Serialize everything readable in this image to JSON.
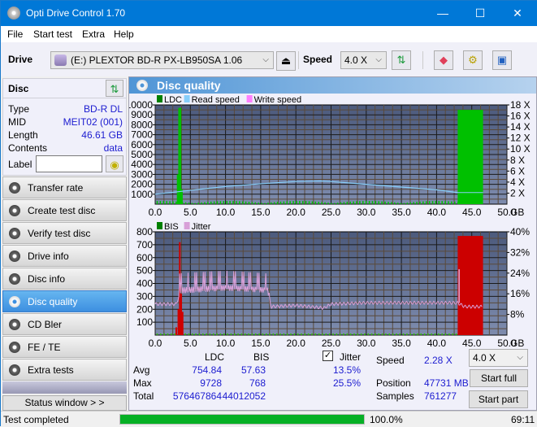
{
  "window": {
    "title": "Opti Drive Control 1.70",
    "minimize": "—",
    "maximize": "☐",
    "close": "✕"
  },
  "menu": [
    "File",
    "Start test",
    "Extra",
    "Help"
  ],
  "toolbar": {
    "drive_label": "Drive",
    "drive_value": "(E:)  PLEXTOR BD-R  PX-LB950SA 1.06",
    "speed_label": "Speed",
    "speed_value": "4.0 X"
  },
  "disc": {
    "header": "Disc",
    "rows": [
      {
        "key": "Type",
        "value": "BD-R DL"
      },
      {
        "key": "MID",
        "value": "MEIT02 (001)"
      },
      {
        "key": "Length",
        "value": "46.61 GB"
      },
      {
        "key": "Contents",
        "value": "data"
      }
    ],
    "label_key": "Label",
    "label_value": ""
  },
  "nav": [
    {
      "label": "Transfer rate",
      "active": false
    },
    {
      "label": "Create test disc",
      "active": false
    },
    {
      "label": "Verify test disc",
      "active": false
    },
    {
      "label": "Drive info",
      "active": false
    },
    {
      "label": "Disc info",
      "active": false
    },
    {
      "label": "Disc quality",
      "active": true
    },
    {
      "label": "CD Bler",
      "active": false
    },
    {
      "label": "FE / TE",
      "active": false
    },
    {
      "label": "Extra tests",
      "active": false
    }
  ],
  "status_window_button": "Status window > >",
  "panel_title": "Disc quality",
  "chart_data": [
    {
      "type": "bar",
      "title": "",
      "legend": [
        "LDC",
        "Read speed",
        "Write speed"
      ],
      "legend_colors": {
        "LDC": "#008000",
        "Read speed": "#87cefa",
        "Write speed": "#ff80ff"
      },
      "xlabel": "GB",
      "x_ticks": [
        "0.0",
        "5.0",
        "10.0",
        "15.0",
        "20.0",
        "25.0",
        "30.0",
        "35.0",
        "40.0",
        "45.0",
        "50.0"
      ],
      "xlim": [
        0,
        50
      ],
      "y_ticks_left": [
        "1000",
        "2000",
        "3000",
        "4000",
        "5000",
        "6000",
        "7000",
        "8000",
        "9000",
        "10000"
      ],
      "ylim_left": [
        0,
        10000
      ],
      "y_ticks_right": [
        "2 X",
        "4 X",
        "6 X",
        "8 X",
        "10 X",
        "12 X",
        "14 X",
        "16 X",
        "18 X"
      ],
      "ylim_right": [
        0,
        18
      ],
      "series": [
        {
          "name": "LDC spikes",
          "points": [
            [
              3.2,
              3000
            ],
            [
              3.4,
              9700
            ],
            [
              3.6,
              9728
            ],
            [
              3.8,
              1500
            ]
          ]
        },
        {
          "name": "LDC block",
          "range": [
            43.0,
            46.6
          ],
          "value": 9500
        },
        {
          "name": "LDC baseline",
          "value_approx": 250
        },
        {
          "name": "Read speed",
          "x": [
            0,
            5,
            10,
            15,
            20,
            23.5,
            25,
            30,
            35,
            40,
            43
          ],
          "values": [
            1.8,
            2.5,
            3.2,
            3.7,
            4.1,
            4.2,
            4.1,
            3.6,
            3.1,
            2.6,
            2.1
          ]
        }
      ]
    },
    {
      "type": "bar",
      "legend": [
        "BIS",
        "Jitter"
      ],
      "legend_colors": {
        "BIS": "#008000",
        "Jitter": "#d8a0d8"
      },
      "xlabel": "GB",
      "x_ticks": [
        "0.0",
        "5.0",
        "10.0",
        "15.0",
        "20.0",
        "25.0",
        "30.0",
        "35.0",
        "40.0",
        "45.0",
        "50.0"
      ],
      "xlim": [
        0,
        50
      ],
      "y_ticks_left": [
        "100",
        "200",
        "300",
        "400",
        "500",
        "600",
        "700",
        "800"
      ],
      "ylim_left": [
        0,
        800
      ],
      "y_ticks_right": [
        "8%",
        "16%",
        "24%",
        "32%",
        "40%"
      ],
      "ylim_right": [
        0,
        40
      ],
      "series": [
        {
          "name": "BIS spikes",
          "points": [
            [
              3.0,
              60
            ],
            [
              3.3,
              200
            ],
            [
              3.5,
              720
            ],
            [
              3.7,
              320
            ],
            [
              3.9,
              180
            ]
          ]
        },
        {
          "name": "BIS block",
          "range": [
            43.0,
            46.6
          ],
          "value": 768
        },
        {
          "name": "Jitter",
          "x": [
            0,
            3,
            3.5,
            10,
            16,
            16.5,
            20,
            24,
            25,
            30,
            35,
            40,
            43,
            44,
            46.5
          ],
          "values": [
            12,
            12,
            16,
            17,
            16,
            11,
            11.5,
            10.5,
            12,
            12.5,
            12.5,
            12.5,
            12.5,
            11,
            11
          ]
        }
      ]
    }
  ],
  "stats": {
    "col_ldc": "LDC",
    "col_bis": "BIS",
    "jitter_label": "Jitter",
    "jitter_checked": true,
    "rows": [
      {
        "label": "Avg",
        "ldc": "754.84",
        "bis": "57.63",
        "jitter": "13.5%"
      },
      {
        "label": "Max",
        "ldc": "9728",
        "bis": "768",
        "jitter": "25.5%"
      },
      {
        "label": "Total",
        "ldc": "576467864",
        "bis": "44012052",
        "jitter": ""
      }
    ],
    "speed_label": "Speed",
    "speed_value": "2.28 X",
    "position_label": "Position",
    "position_value": "47731 MB",
    "samples_label": "Samples",
    "samples_value": "761277",
    "speed_select": "4.0 X",
    "start_full": "Start full",
    "start_part": "Start part"
  },
  "status": {
    "text": "Test completed",
    "progress": 100.0,
    "progress_text": "100.0%",
    "elapsed": "69:11"
  }
}
